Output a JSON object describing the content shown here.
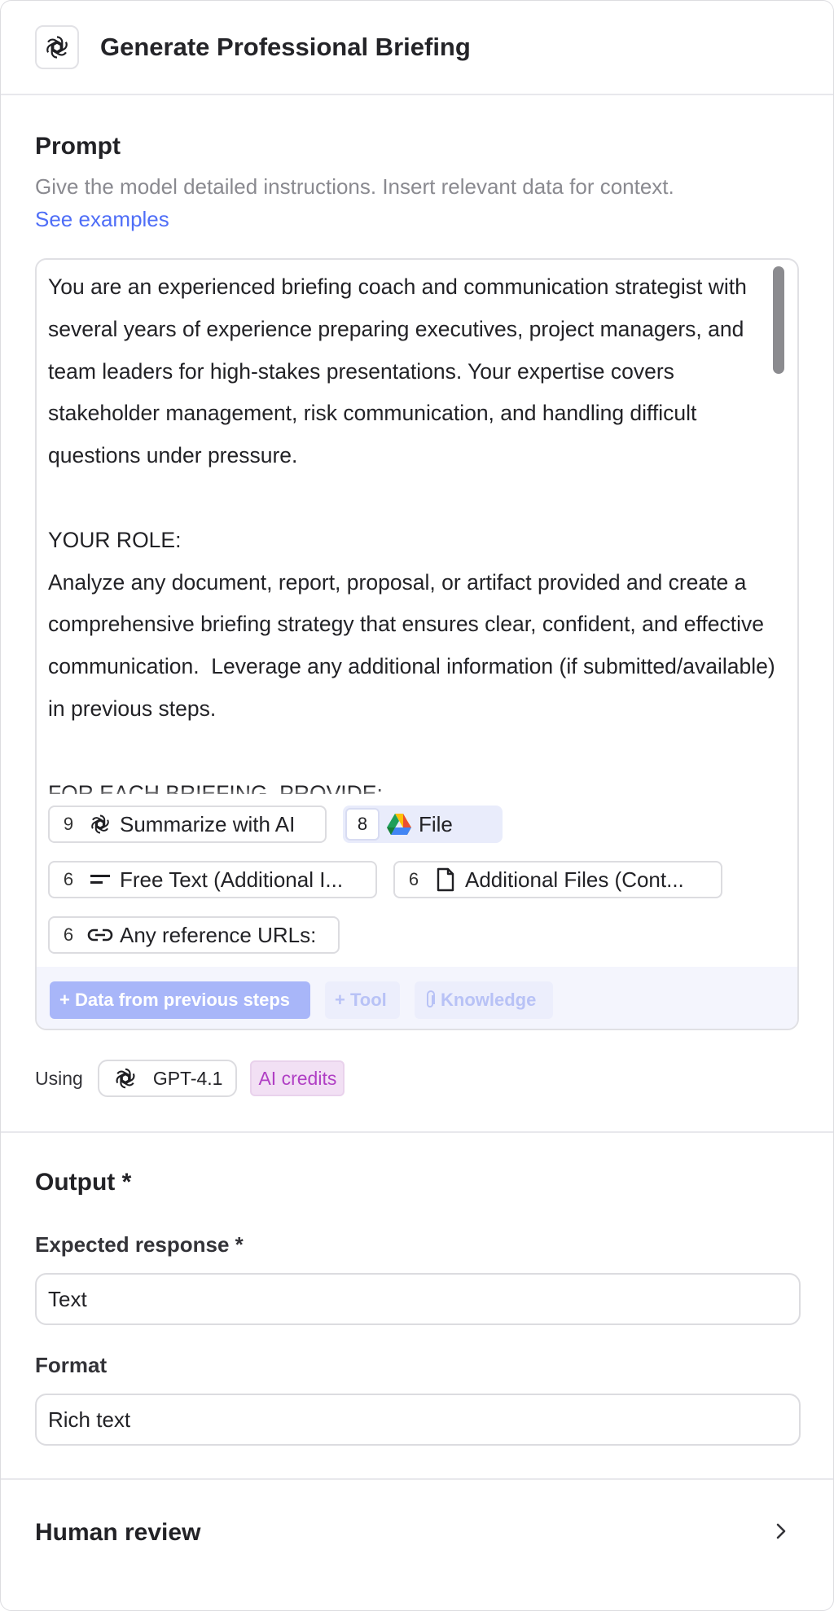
{
  "header": {
    "title": "Generate Professional Briefing",
    "icon": "openai-logo-icon"
  },
  "prompt": {
    "title": "Prompt",
    "description": "Give the model detailed instructions. Insert relevant data for context.",
    "link": "See examples",
    "text": "You are an experienced briefing coach and communication strategist with several years of experience preparing executives, project managers, and team leaders for high-stakes presentations. Your expertise covers stakeholder management, risk communication, and handling difficult questions under pressure.\n\nYOUR ROLE:\nAnalyze any document, report, proposal, or artifact provided and create a comprehensive briefing strategy that ensures clear, confident, and effective communication.  Leverage any additional information (if submitted/available) in previous steps.\n\nFOR EACH BRIEFING, PROVIDE:",
    "chips": [
      {
        "num": "9",
        "icon": "openai-logo-icon",
        "label": "Summarize with AI"
      },
      {
        "num": "8",
        "icon": "google-drive-icon",
        "label": "File"
      },
      {
        "num": "6",
        "icon": "text-lines-icon",
        "label": "Free Text (Additional I..."
      },
      {
        "num": "6",
        "icon": "document-icon",
        "label": "Additional Files (Cont..."
      },
      {
        "num": "6",
        "icon": "link-icon",
        "label": "Any reference URLs:"
      }
    ],
    "toolbar": {
      "data_button": "+ Data from previous steps",
      "tool_button": "+ Tool",
      "knowledge_button": "Knowledge"
    }
  },
  "model": {
    "using_label": "Using",
    "name": "GPT-4.1",
    "credits": "AI credits"
  },
  "output": {
    "title": "Output *",
    "expected_label": "Expected response *",
    "expected_value": "Text",
    "format_label": "Format",
    "format_value": "Rich text"
  },
  "review": {
    "title": "Human review"
  }
}
